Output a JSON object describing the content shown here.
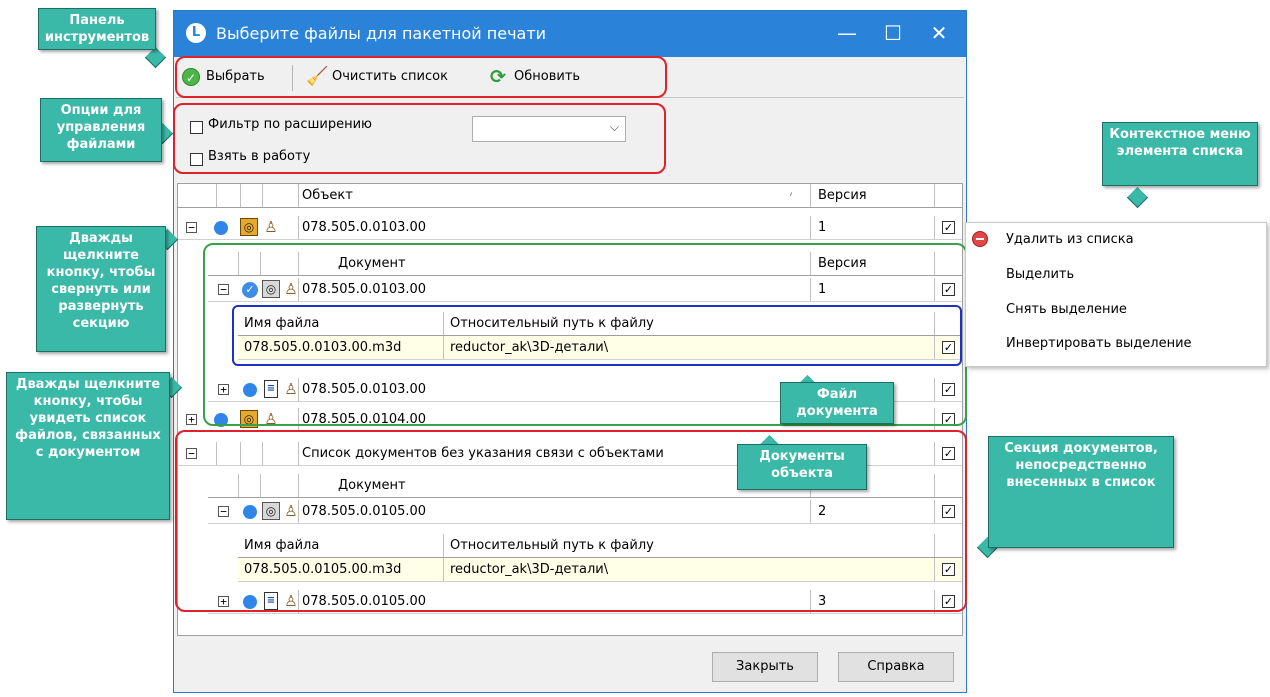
{
  "window": {
    "title": "Выберите файлы для пакетной печати",
    "minimize": "—",
    "maximize": "☐",
    "close": "✕"
  },
  "toolbar": {
    "select_label": "Выбрать",
    "clear_label": "Очистить список",
    "refresh_label": "Обновить"
  },
  "options": {
    "filter_label": "Фильтр по расширению",
    "filter_value": "",
    "take_label": "Взять в работу"
  },
  "grid": {
    "headers": {
      "object": "Объект",
      "version": "Версия",
      "sort_mark": "⁄"
    },
    "objects": [
      {
        "name": "078.505.0.0103.00",
        "version": "1",
        "expanded": "−"
      },
      {
        "name": "078.505.0.0104.00",
        "version": "",
        "expanded": "+"
      }
    ],
    "sub_headers": {
      "document": "Документ",
      "version": "Версия"
    },
    "documents": [
      {
        "name": "078.505.0.0103.00",
        "version": "1",
        "expanded": "−"
      },
      {
        "name": "078.505.0.0103.00",
        "version": "",
        "expanded": "+"
      }
    ],
    "file_headers": {
      "name": "Имя файла",
      "path": "Относительный путь к файлу"
    },
    "files": [
      {
        "name": "078.505.0.0103.00.m3d",
        "path": "reductor_ak\\3D-детали\\"
      }
    ],
    "unlinked_section": {
      "label": "Список документов без указания связи с объектами",
      "expanded": "−"
    },
    "unlinked_sub_header": {
      "document": "Документ"
    },
    "unlinked_documents": [
      {
        "name": "078.505.0.0105.00",
        "version": "2",
        "expanded": "−"
      },
      {
        "name": "078.505.0.0105.00",
        "version": "3",
        "expanded": "+"
      }
    ],
    "unlinked_files": [
      {
        "name": "078.505.0.0105.00.m3d",
        "path": "reductor_ak\\3D-детали\\"
      }
    ]
  },
  "buttons": {
    "close": "Закрыть",
    "help": "Справка"
  },
  "context_menu": {
    "items": [
      "Удалить из списка",
      "Выделить",
      "Снять выделение",
      "Инвертировать выделение"
    ]
  },
  "callouts": {
    "toolbar": "Панель инструментов",
    "options": "Опции для управления файлами",
    "collapse": "Дважды щелкните кнопку, чтобы свернуть или развернуть секцию",
    "show_files": "Дважды щелкните кнопку, чтобы увидеть список файлов, связанных с документом",
    "context_menu": "Контекстное меню элемента списка",
    "doc_file": "Файл документа",
    "object_docs": "Документы объекта",
    "direct_section": "Секция документов, непосредственно внесенных в список"
  },
  "colors": {
    "title_bar": "#2b82d9",
    "callout_bg": "#3bb9a8",
    "frame_red": "#e0202a",
    "frame_green": "#3aa04a",
    "frame_blue": "#2030c0",
    "file_row_bg": "#ffffe8"
  },
  "icons": [
    "app-icon",
    "check-icon",
    "broom-icon",
    "refresh-icon",
    "blue-dot-icon",
    "part-icon",
    "document-icon",
    "stamp-icon",
    "delete-icon"
  ]
}
